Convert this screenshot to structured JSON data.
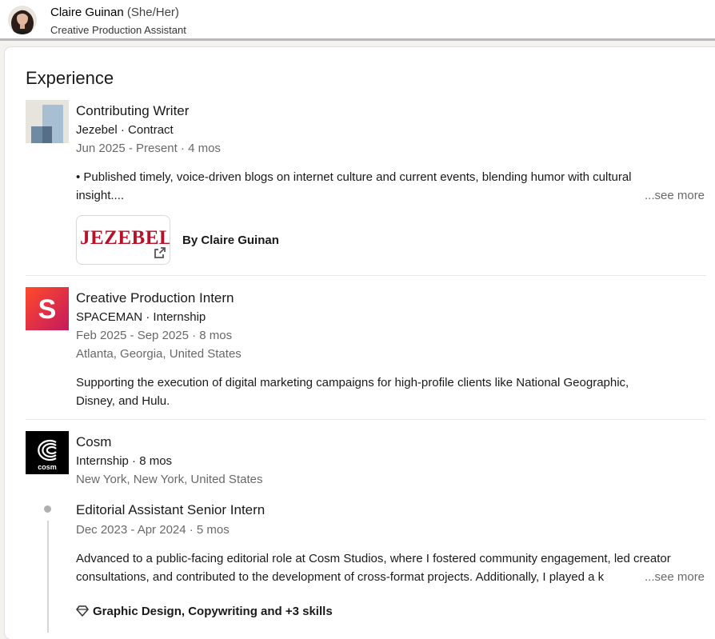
{
  "header": {
    "name": "Claire Guinan",
    "pronouns": "(She/Her)",
    "headline": "Creative Production Assistant"
  },
  "section": {
    "title": "Experience"
  },
  "experiences": [
    {
      "title": "Contributing Writer",
      "company_line": "Jezebel · Contract",
      "dates": "Jun 2025 - Present · 4 mos",
      "description_line1": "• Published timely, voice-driven blogs on internet culture and current events, blending humor with cultural",
      "description_line2": "insight....",
      "see_more": "...see more",
      "media": {
        "brand": "JEZEBEL",
        "caption": "By Claire Guinan",
        "icon": "external-link-icon"
      }
    },
    {
      "title": "Creative Production Intern",
      "company_line": "SPACEMAN · Internship",
      "dates": "Feb 2025 - Sep 2025 · 8 mos",
      "location": "Atlanta, Georgia, United States",
      "logo_letter": "S",
      "description_line1": "Supporting the execution of digital marketing campaigns for high-profile clients like National Geographic,",
      "description_line2": "Disney, and Hulu."
    },
    {
      "company": "Cosm",
      "company_line": "Internship · 8 mos",
      "location": "New York, New York, United States",
      "logo_text": "cosm",
      "roles": [
        {
          "title": "Editorial Assistant Senior Intern",
          "dates": "Dec 2023 - Apr 2024 · 5 mos",
          "description_line1": "Advanced to a public-facing editorial role at Cosm Studios, where I fostered community engagement, led creator",
          "description_line2": "consultations, and contributed to the development of cross-format projects. Additionally, I played a k",
          "see_more": "...see more",
          "skills": "Graphic Design, Copywriting and +3 skills"
        }
      ]
    }
  ],
  "colors": {
    "page_bg": "#f4f2ee",
    "jezebel_red": "#b8122a",
    "spaceman_gradient": [
      "#ff3d2e",
      "#c2185b"
    ],
    "cosm_bg": "#000000"
  }
}
